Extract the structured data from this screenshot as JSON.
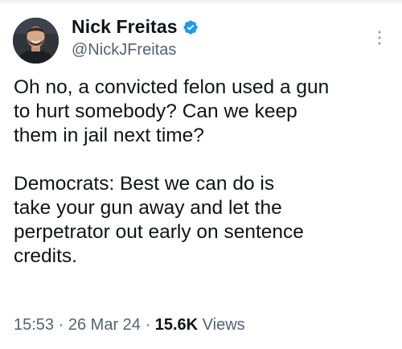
{
  "author": {
    "display_name": "Nick Freitas",
    "handle": "@NickJFreitas",
    "verified": true,
    "verified_color": "#1d9bf0"
  },
  "tweet": {
    "text": "Oh no, a convicted felon used a gun\nto hurt somebody? Can we keep\nthem in jail next time?\n\nDemocrats: Best we can do is\ntake your gun away and let the\nperpetrator out early on sentence\ncredits."
  },
  "meta": {
    "time": "15:53",
    "separator": "·",
    "date": "26 Mar 24",
    "views_count": "15.6K",
    "views_label": "Views"
  },
  "icons": {
    "verified": "verified-badge-icon",
    "more": "more-vertical-icon"
  },
  "colors": {
    "text_primary": "#0f1419",
    "text_secondary": "#536471"
  }
}
